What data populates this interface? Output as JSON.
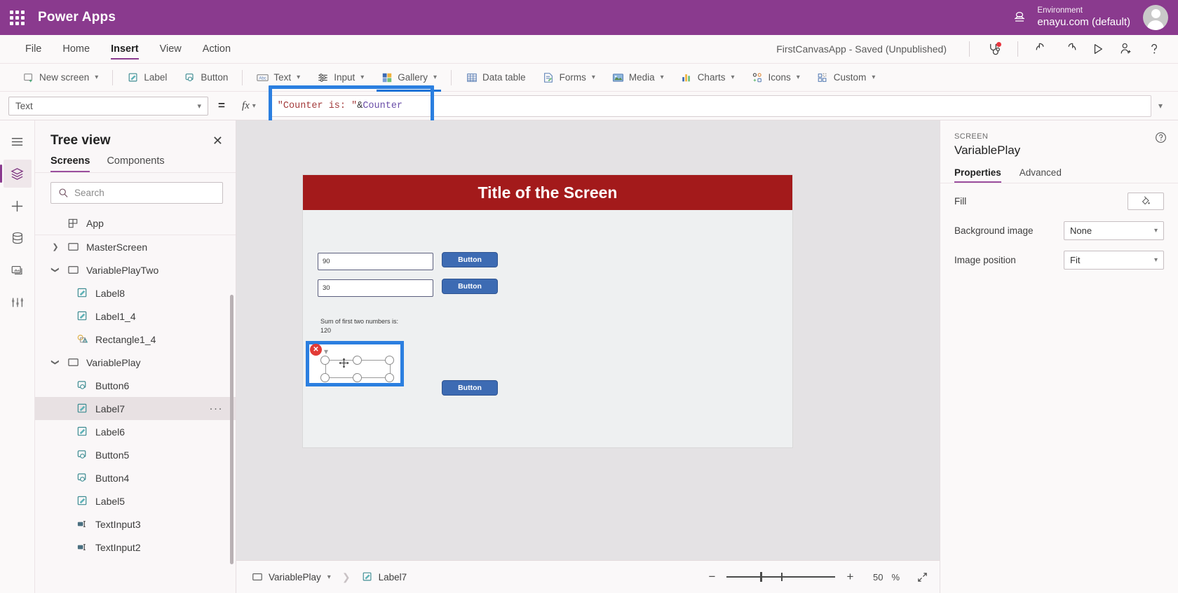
{
  "topbar": {
    "waffle_icon": "waffle-icon",
    "brand": "Power Apps",
    "environment_label": "Environment",
    "environment_value": "enayu.com (default)",
    "environment_icon": "environment-icon",
    "avatar": "user-avatar"
  },
  "menubar": {
    "items": [
      {
        "label": "File",
        "active": false
      },
      {
        "label": "Home",
        "active": false
      },
      {
        "label": "Insert",
        "active": true
      },
      {
        "label": "View",
        "active": false
      },
      {
        "label": "Action",
        "active": false
      }
    ],
    "saved_status": "FirstCanvasApp - Saved (Unpublished)",
    "icons": [
      {
        "name": "app-checker-icon",
        "glyph": "stethoscope",
        "badge": true
      },
      {
        "name": "undo-icon",
        "glyph": "undo"
      },
      {
        "name": "redo-icon",
        "glyph": "redo"
      },
      {
        "name": "preview-play-icon",
        "glyph": "play"
      },
      {
        "name": "share-user-icon",
        "glyph": "user-add"
      },
      {
        "name": "help-icon",
        "glyph": "question"
      }
    ]
  },
  "ribbon": {
    "items": [
      {
        "label": "New screen",
        "icon": "new-screen-icon",
        "caret": true
      },
      {
        "label": "Label",
        "icon": "label-icon",
        "caret": false
      },
      {
        "label": "Button",
        "icon": "button-icon",
        "caret": false
      },
      {
        "label": "Text",
        "icon": "text-icon",
        "caret": true
      },
      {
        "label": "Input",
        "icon": "input-icon",
        "caret": true
      },
      {
        "label": "Gallery",
        "icon": "gallery-icon",
        "caret": true
      },
      {
        "label": "Data table",
        "icon": "data-table-icon",
        "caret": false
      },
      {
        "label": "Forms",
        "icon": "forms-icon",
        "caret": true
      },
      {
        "label": "Media",
        "icon": "media-icon",
        "caret": true
      },
      {
        "label": "Charts",
        "icon": "charts-icon",
        "caret": true
      },
      {
        "label": "Icons",
        "icon": "icons-icon",
        "caret": true
      },
      {
        "label": "Custom",
        "icon": "custom-icon",
        "caret": true
      }
    ]
  },
  "formulabar": {
    "property": "Text",
    "equals": "=",
    "fx_label": "fx",
    "formula_parts": [
      {
        "text": "\"Counter is: \"",
        "kind": "string"
      },
      {
        "text": " & ",
        "kind": "operator"
      },
      {
        "text": "Counter",
        "kind": "identifier"
      }
    ],
    "formula_full": "\"Counter is: \" & Counter",
    "highlighted": true,
    "highlight_color": "#2b7fe0"
  },
  "rail": {
    "items": [
      {
        "name": "hamburger-icon",
        "active": false
      },
      {
        "name": "tree-view-icon",
        "active": true
      },
      {
        "name": "insert-plus-icon",
        "active": false
      },
      {
        "name": "data-icon",
        "active": false
      },
      {
        "name": "media-library-icon",
        "active": false
      },
      {
        "name": "advanced-tools-icon",
        "active": false
      }
    ]
  },
  "treeview": {
    "title": "Tree view",
    "close_icon": "close-icon",
    "tabs": [
      {
        "label": "Screens",
        "active": true
      },
      {
        "label": "Components",
        "active": false
      }
    ],
    "search_placeholder": "Search",
    "search_value": "",
    "nodes": [
      {
        "label": "App",
        "icon": "app-icon",
        "indent": 0,
        "chevron": "",
        "selected": false,
        "divider": true
      },
      {
        "label": "MasterScreen",
        "icon": "screen-icon",
        "indent": 0,
        "chevron": "collapsed",
        "selected": false
      },
      {
        "label": "VariablePlayTwo",
        "icon": "screen-icon",
        "indent": 0,
        "chevron": "expanded",
        "selected": false
      },
      {
        "label": "Label8",
        "icon": "label-icon",
        "indent": 1,
        "chevron": "",
        "selected": false
      },
      {
        "label": "Label1_4",
        "icon": "label-icon",
        "indent": 1,
        "chevron": "",
        "selected": false
      },
      {
        "label": "Rectangle1_4",
        "icon": "shape-icon",
        "indent": 1,
        "chevron": "",
        "selected": false
      },
      {
        "label": "VariablePlay",
        "icon": "screen-icon",
        "indent": 0,
        "chevron": "expanded",
        "selected": false
      },
      {
        "label": "Button6",
        "icon": "button-icon",
        "indent": 1,
        "chevron": "",
        "selected": false
      },
      {
        "label": "Label7",
        "icon": "label-icon",
        "indent": 1,
        "chevron": "",
        "selected": true,
        "more": "···"
      },
      {
        "label": "Label6",
        "icon": "label-icon",
        "indent": 1,
        "chevron": "",
        "selected": false
      },
      {
        "label": "Button5",
        "icon": "button-icon",
        "indent": 1,
        "chevron": "",
        "selected": false
      },
      {
        "label": "Button4",
        "icon": "button-icon",
        "indent": 1,
        "chevron": "",
        "selected": false
      },
      {
        "label": "Label5",
        "icon": "label-icon",
        "indent": 1,
        "chevron": "",
        "selected": false
      },
      {
        "label": "TextInput3",
        "icon": "textinput-icon",
        "indent": 1,
        "chevron": "",
        "selected": false
      },
      {
        "label": "TextInput2",
        "icon": "textinput-icon",
        "indent": 1,
        "chevron": "",
        "selected": false
      }
    ]
  },
  "canvas": {
    "screen_title": "Title of the Screen",
    "title_bar_color": "#a31a1b",
    "screen_fill": "#eef0f1",
    "textinputs": [
      {
        "value": "90"
      },
      {
        "value": "30"
      }
    ],
    "buttons": [
      {
        "label": "Button"
      },
      {
        "label": "Button"
      },
      {
        "label": "Button"
      }
    ],
    "labels": [
      {
        "text": "Sum of first two numbers is: 120"
      },
      {
        "text": "Sum of first two numbers is: 120"
      }
    ],
    "selection": {
      "selected_control": "Label7",
      "outline_color": "#2b7fe0",
      "delete_icon": "delete-icon",
      "move_icon": "move-icon",
      "chevron_icon": "chevron-down-icon"
    }
  },
  "statusbar": {
    "breadcrumb": [
      {
        "label": "VariablePlay",
        "icon": "screen-icon",
        "caret": true
      },
      {
        "label": "Label7",
        "icon": "label-icon",
        "caret": false
      }
    ],
    "zoom_out_icon": "minus-icon",
    "zoom_in_icon": "plus-icon",
    "zoom_value": "50",
    "zoom_unit": "%",
    "fullscreen_icon": "fullscreen-icon"
  },
  "properties": {
    "kind": "SCREEN",
    "name": "VariablePlay",
    "help_icon": "help-circle-icon",
    "tabs": [
      {
        "label": "Properties",
        "active": true
      },
      {
        "label": "Advanced",
        "active": false
      }
    ],
    "rows": [
      {
        "label": "Fill",
        "control": "color-swatch",
        "value": ""
      },
      {
        "label": "Background image",
        "control": "select",
        "value": "None"
      },
      {
        "label": "Image position",
        "control": "select",
        "value": "Fit"
      }
    ]
  }
}
